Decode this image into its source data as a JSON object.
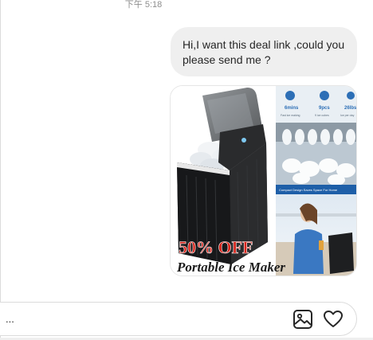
{
  "header": {
    "timestamp": "下午 5:18"
  },
  "message": {
    "text": "Hi,I want this deal link ,could you please send me ?"
  },
  "product_image": {
    "badge": "50% OFF",
    "title": "Portable Ice Maker",
    "specs": [
      {
        "value": "6mins",
        "label": "Fast ice making"
      },
      {
        "value": "9pcs",
        "label": "9 ice cubes"
      },
      {
        "value": "26lbs",
        "label": "Ice per day"
      }
    ],
    "banner": "Compact Design Saves Space For Home",
    "colors": {
      "badge_red": "#d8231a",
      "title_dark": "#1c1c1c"
    }
  },
  "composer": {
    "placeholder": "...",
    "photo_icon": "image-icon",
    "like_icon": "heart-icon"
  }
}
